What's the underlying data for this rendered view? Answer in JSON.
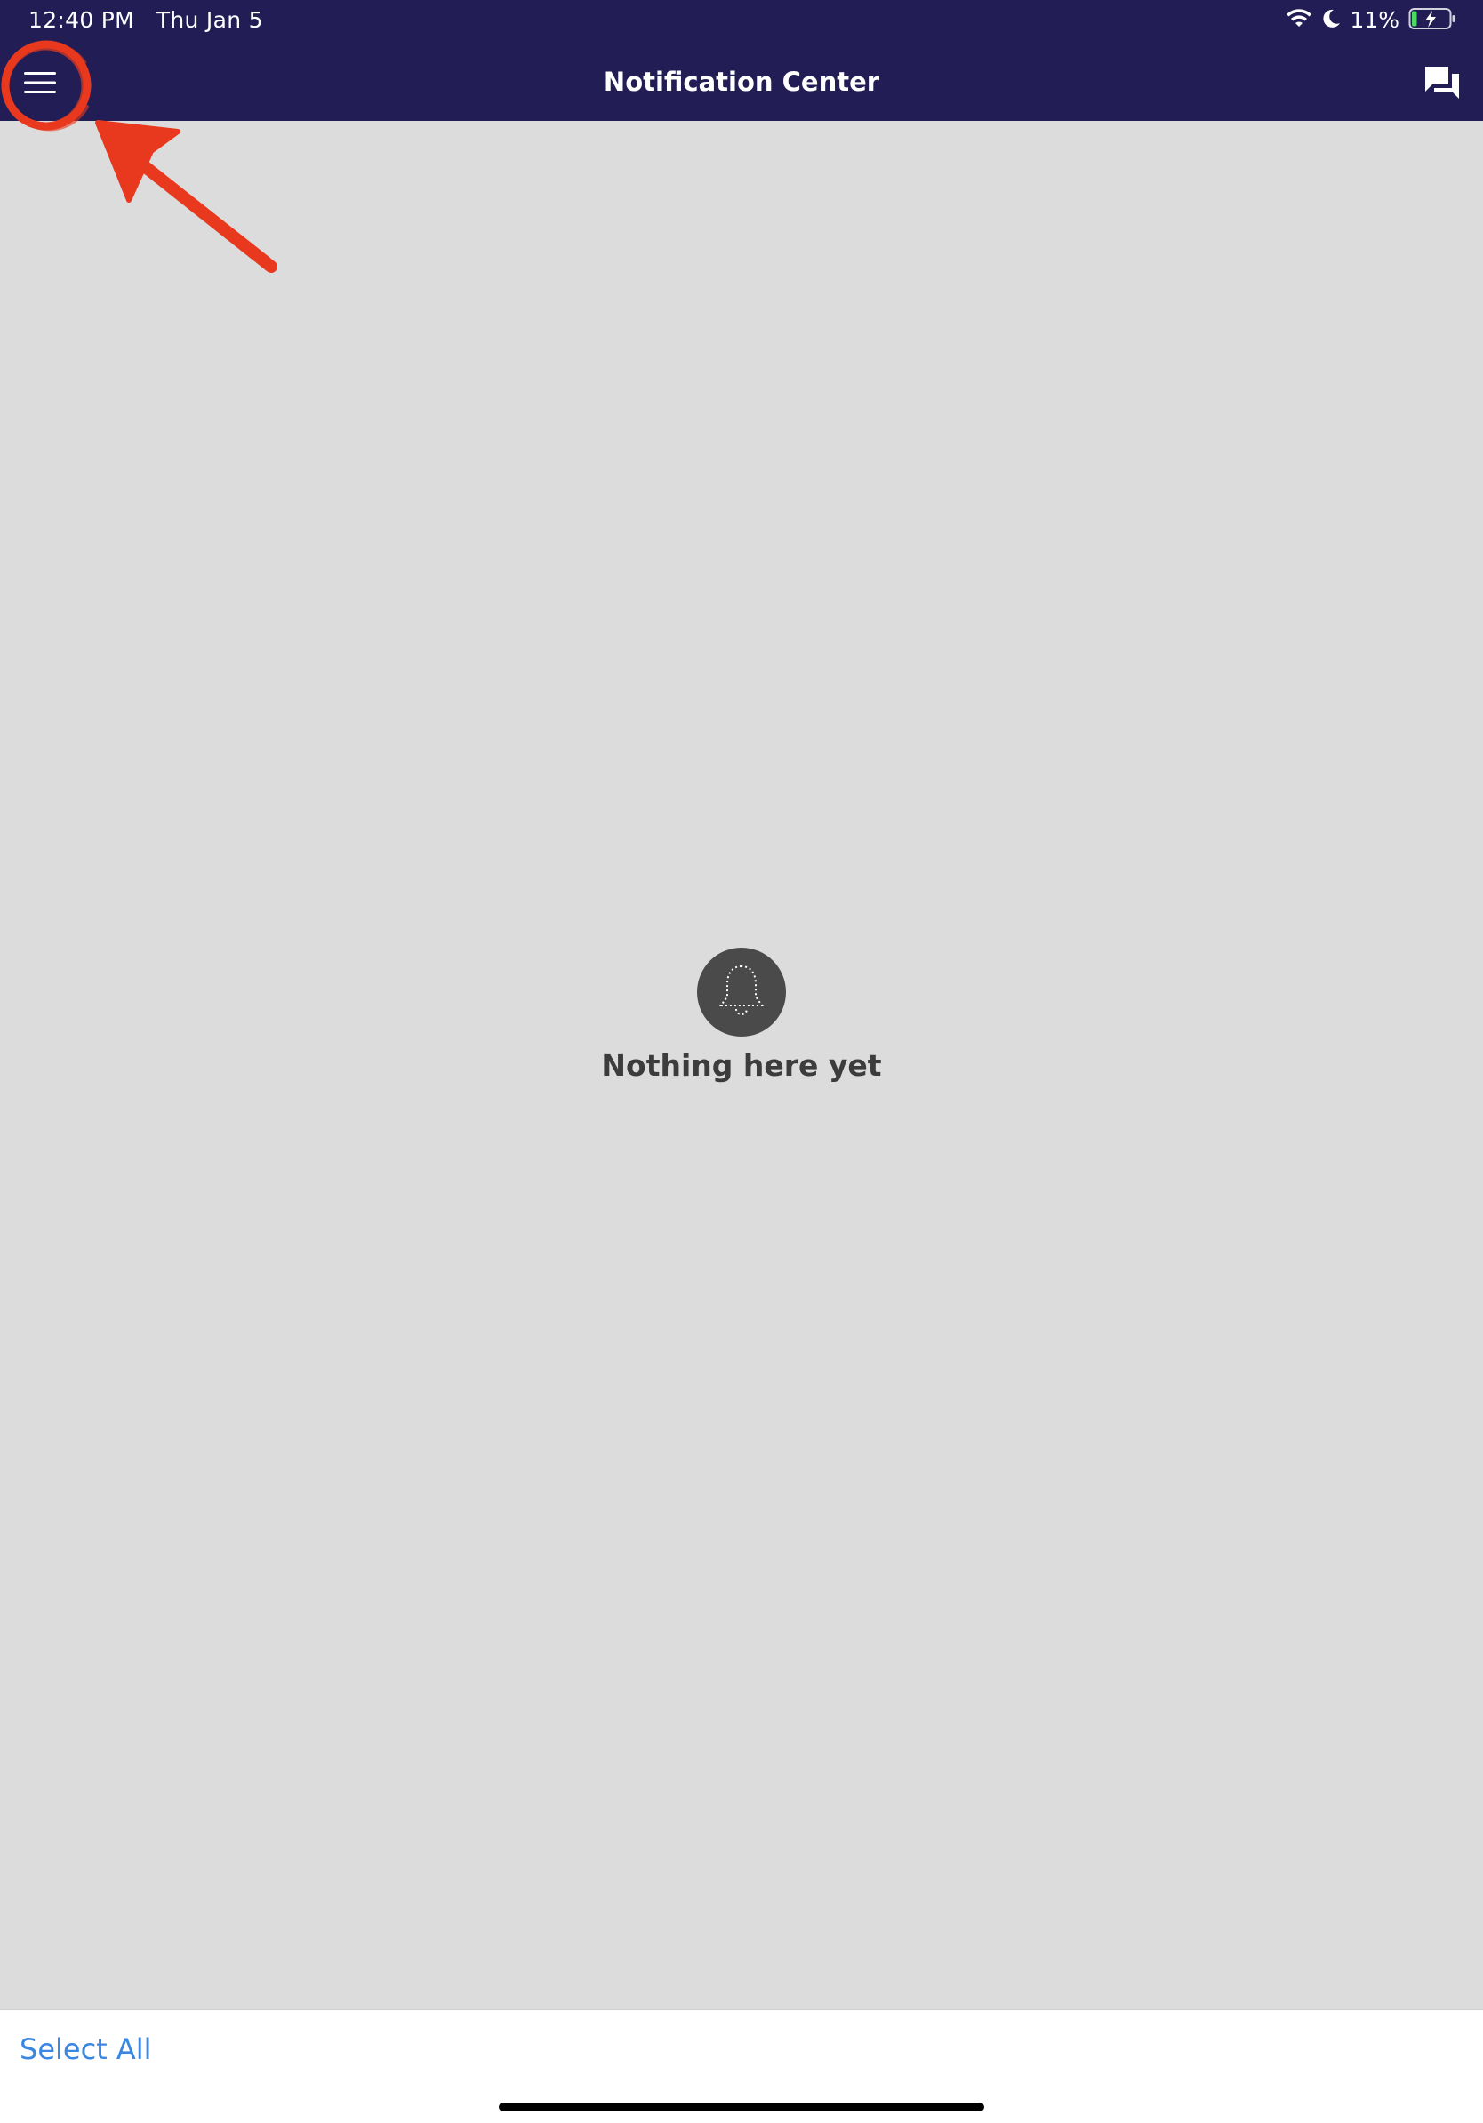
{
  "status_bar": {
    "time": "12:40 PM",
    "date": "Thu Jan 5",
    "battery_percent": "11%",
    "battery_level": 0.11,
    "icons": [
      "wifi-icon",
      "moon-icon",
      "battery-charging-icon"
    ]
  },
  "nav": {
    "title": "Notification Center",
    "left_icon": "hamburger-menu-icon",
    "right_icon": "chat-bubbles-icon"
  },
  "empty_state": {
    "icon": "bell-icon",
    "message": "Nothing here yet"
  },
  "bottom_bar": {
    "select_all_label": "Select All"
  },
  "colors": {
    "header_bg": "#221e55",
    "content_bg": "#dcdcdc",
    "accent_link": "#3a86e3",
    "annotation_red": "#e8391e",
    "empty_icon_bg": "#4a4a4a"
  },
  "annotation": {
    "type": "circle-and-arrow",
    "target": "menu-button"
  }
}
